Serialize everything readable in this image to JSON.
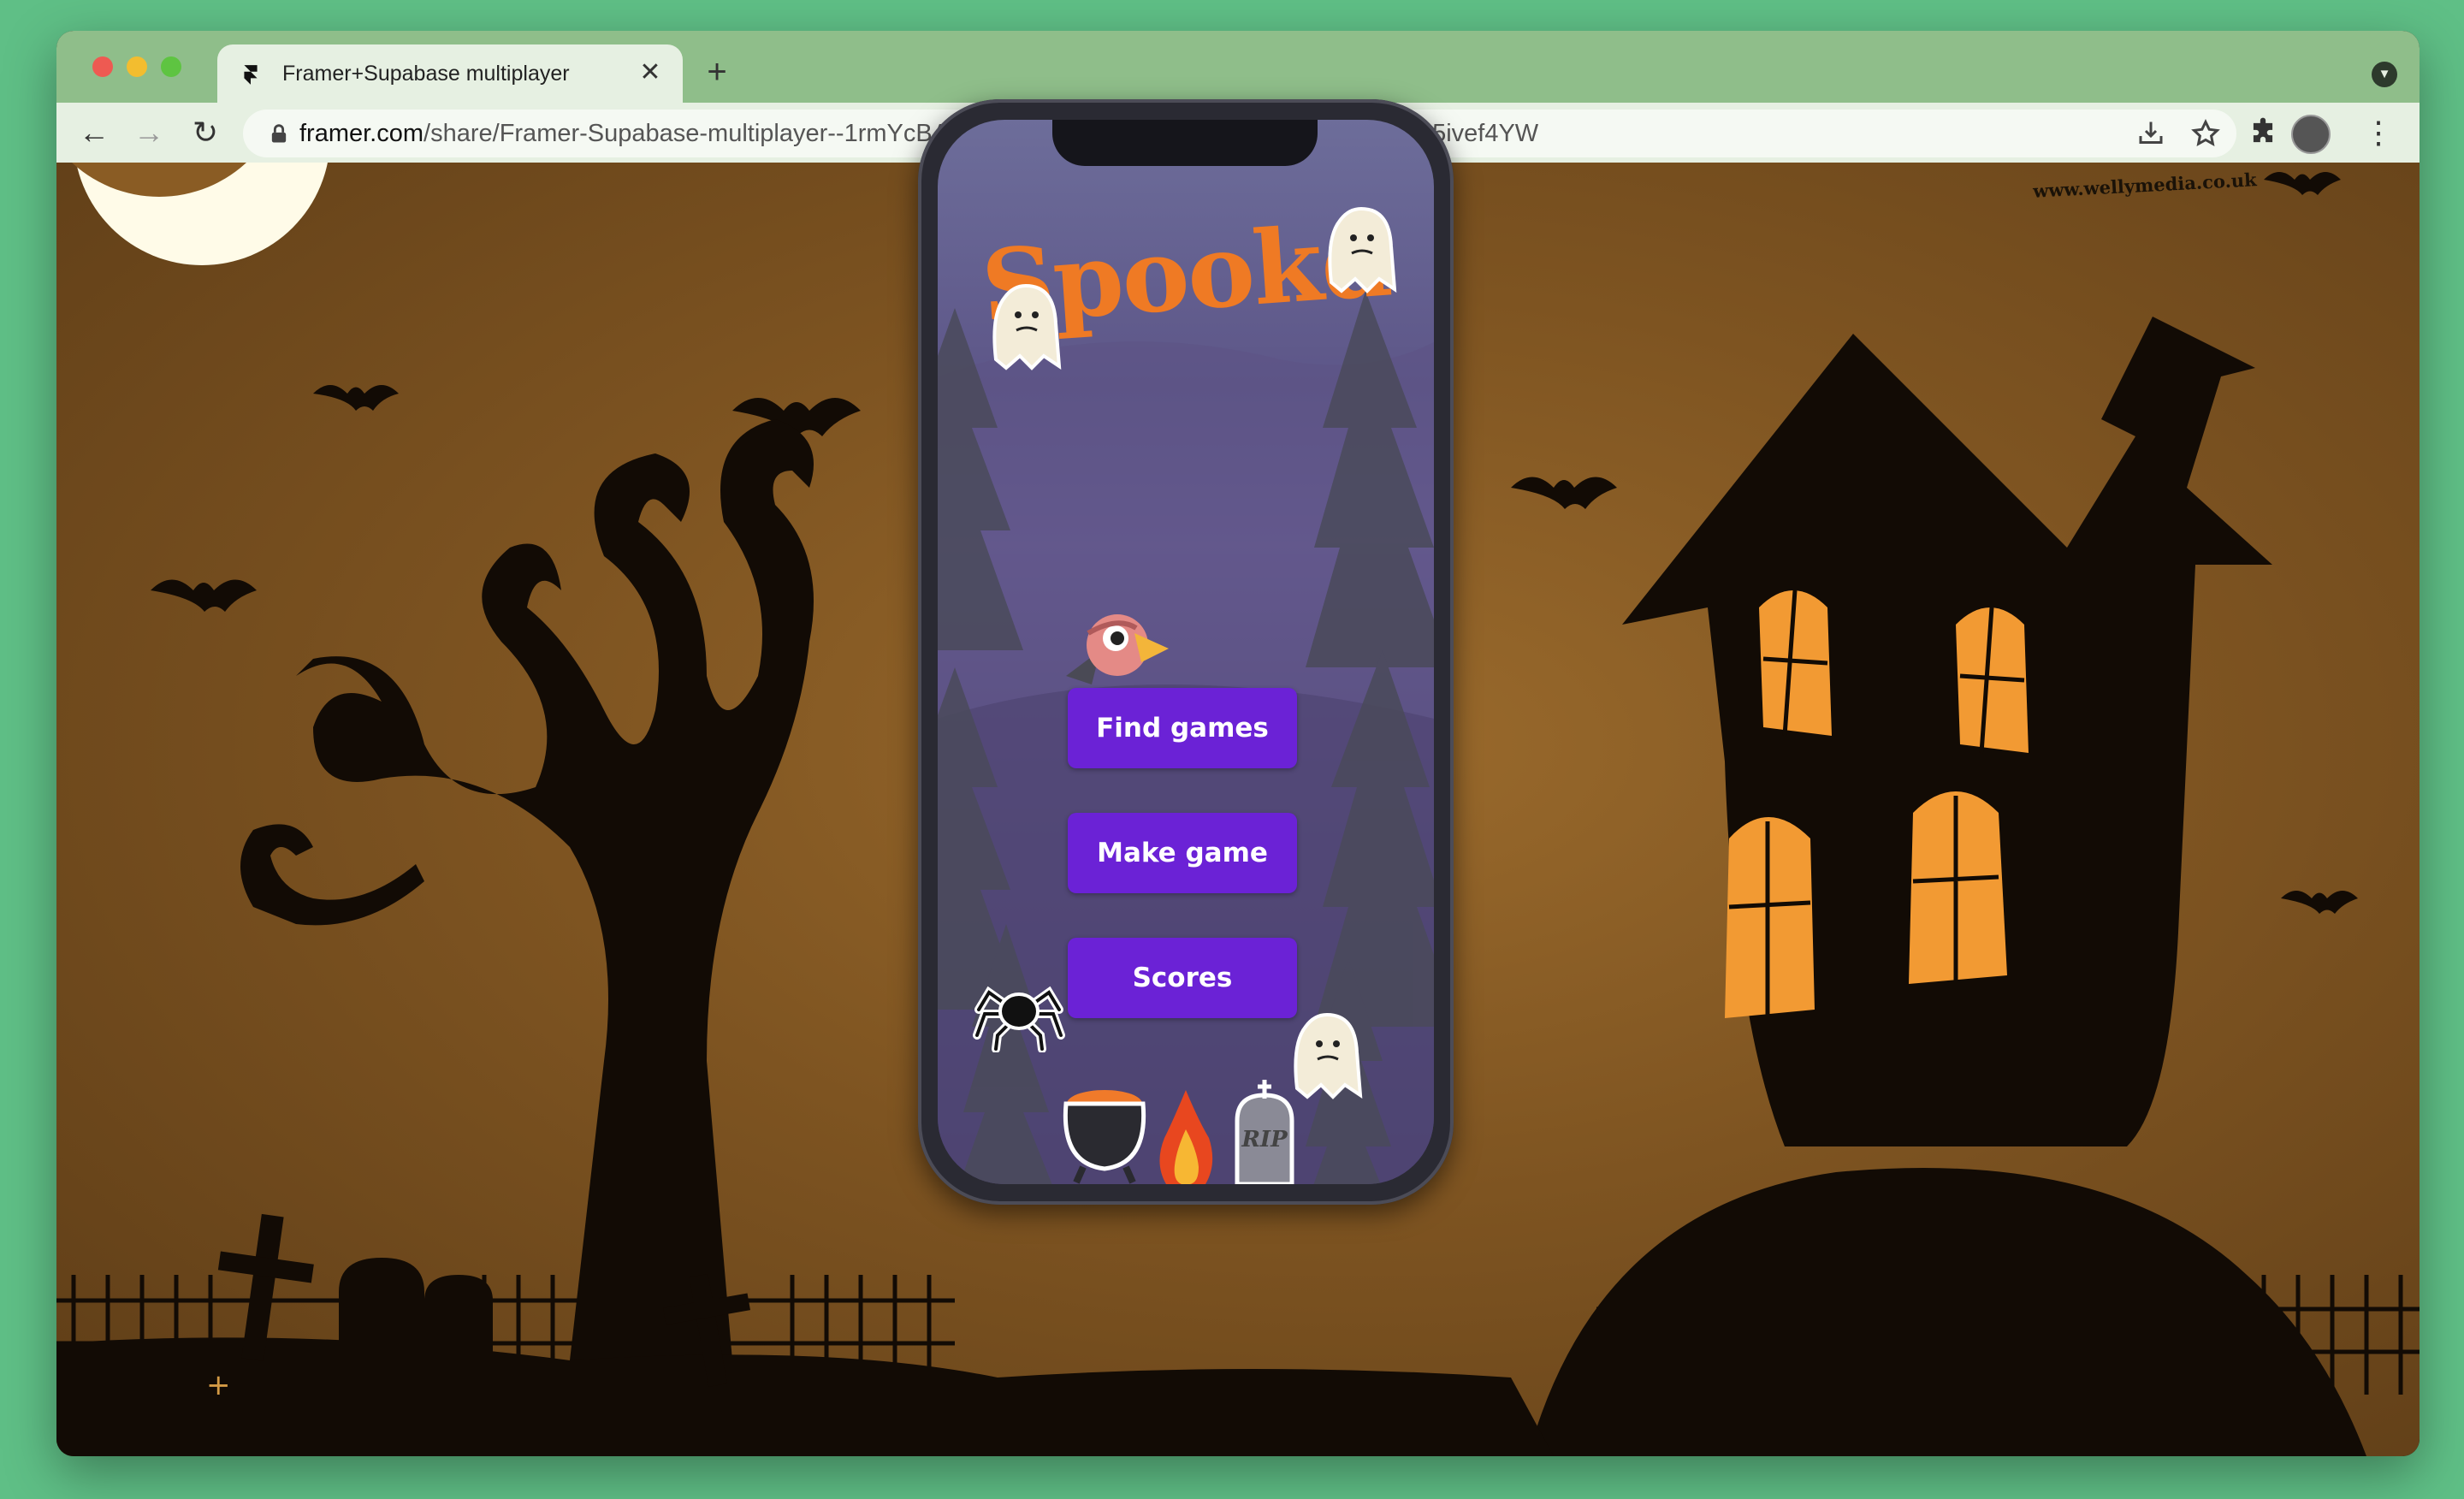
{
  "browser": {
    "tab_title": "Framer+Supabase multiplayer",
    "url_host": "framer.com",
    "url_path": "/share/Framer-Supabase-multiplayer--1rmYcBAnSk0PVvXGrnlc/e0t612XvT?fullscreen=1#A5ivef4YW",
    "new_tab_glyph": "+",
    "close_glyph": "✕"
  },
  "page": {
    "watermark": "www.wellymedia.co.uk"
  },
  "game": {
    "title": "Spookd",
    "buttons": {
      "find": "Find games",
      "make": "Make game",
      "scores": "Scores"
    },
    "tombstone_text": "RIP"
  },
  "colors": {
    "accent": "#6b22d6",
    "title": "#ef7a24",
    "window_glow": "#f29a33"
  }
}
